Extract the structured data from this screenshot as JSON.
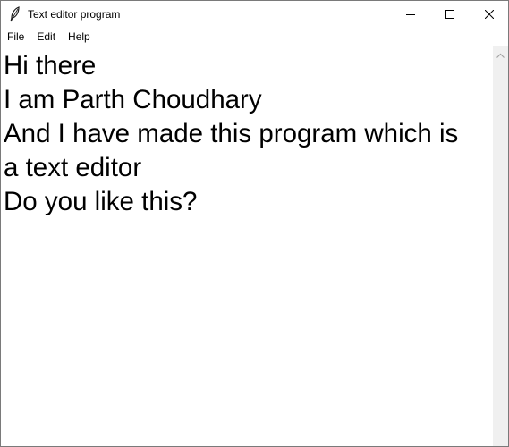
{
  "window": {
    "title": "Text editor program"
  },
  "menu": {
    "items": [
      "File",
      "Edit",
      "Help"
    ]
  },
  "editor": {
    "lines": [
      "Hi there",
      "I am Parth Choudhary",
      "And I have made this program which is",
      "a text editor",
      "Do you like this?"
    ]
  },
  "icons": {
    "app": "feather-icon",
    "minimize": "minimize-icon",
    "maximize": "maximize-icon",
    "close": "close-icon",
    "scroll_up": "chevron-up-icon"
  }
}
